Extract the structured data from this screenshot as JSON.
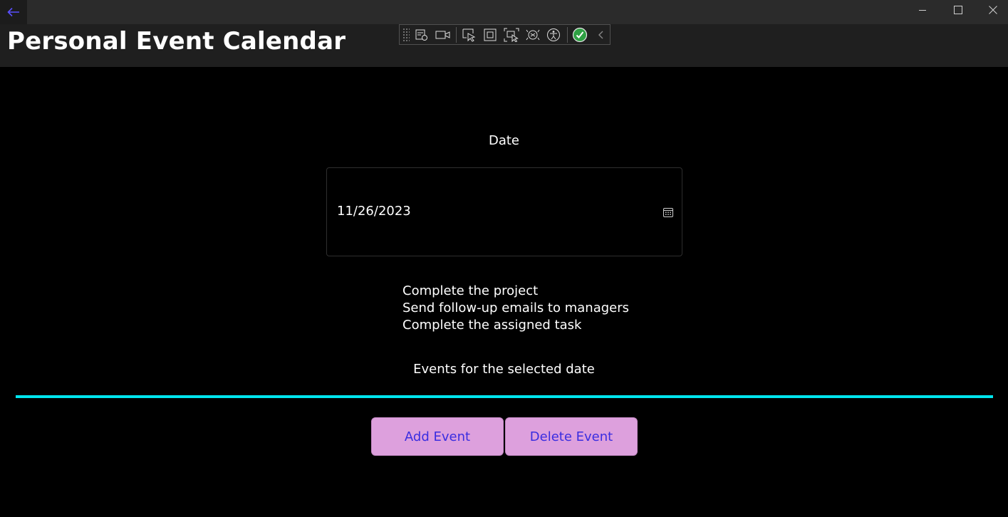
{
  "app": {
    "title": "Personal Event Calendar"
  },
  "window_controls": {
    "back": "back-arrow-icon",
    "minimize": "minimize-icon",
    "maximize": "maximize-icon",
    "close": "close-icon"
  },
  "devtools": {
    "icons": [
      "live-visual-tree-icon",
      "record-icon",
      "select-element-icon",
      "display-layout-adorners-icon",
      "track-focus-icon",
      "binding-failures-icon",
      "accessibility-checker-icon",
      "hot-reload-ok-icon",
      "collapse-chevron-icon"
    ]
  },
  "form": {
    "date_label": "Date",
    "date_value": "11/26/2023",
    "calendar_icon": "calendar-icon"
  },
  "events": {
    "items": [
      "Complete the project",
      "Send follow-up emails to managers",
      "Complete the assigned task"
    ],
    "caption": "Events for the selected date"
  },
  "actions": {
    "add_label": "Add Event",
    "delete_label": "Delete Event"
  },
  "colors": {
    "background": "#000000",
    "title_bar": "#2b2b2b",
    "header": "#1f1f1f",
    "divider": "#00e5ee",
    "button_bg": "#dda0dd",
    "button_text": "#3a2de0",
    "back_arrow": "#5a4fff"
  }
}
